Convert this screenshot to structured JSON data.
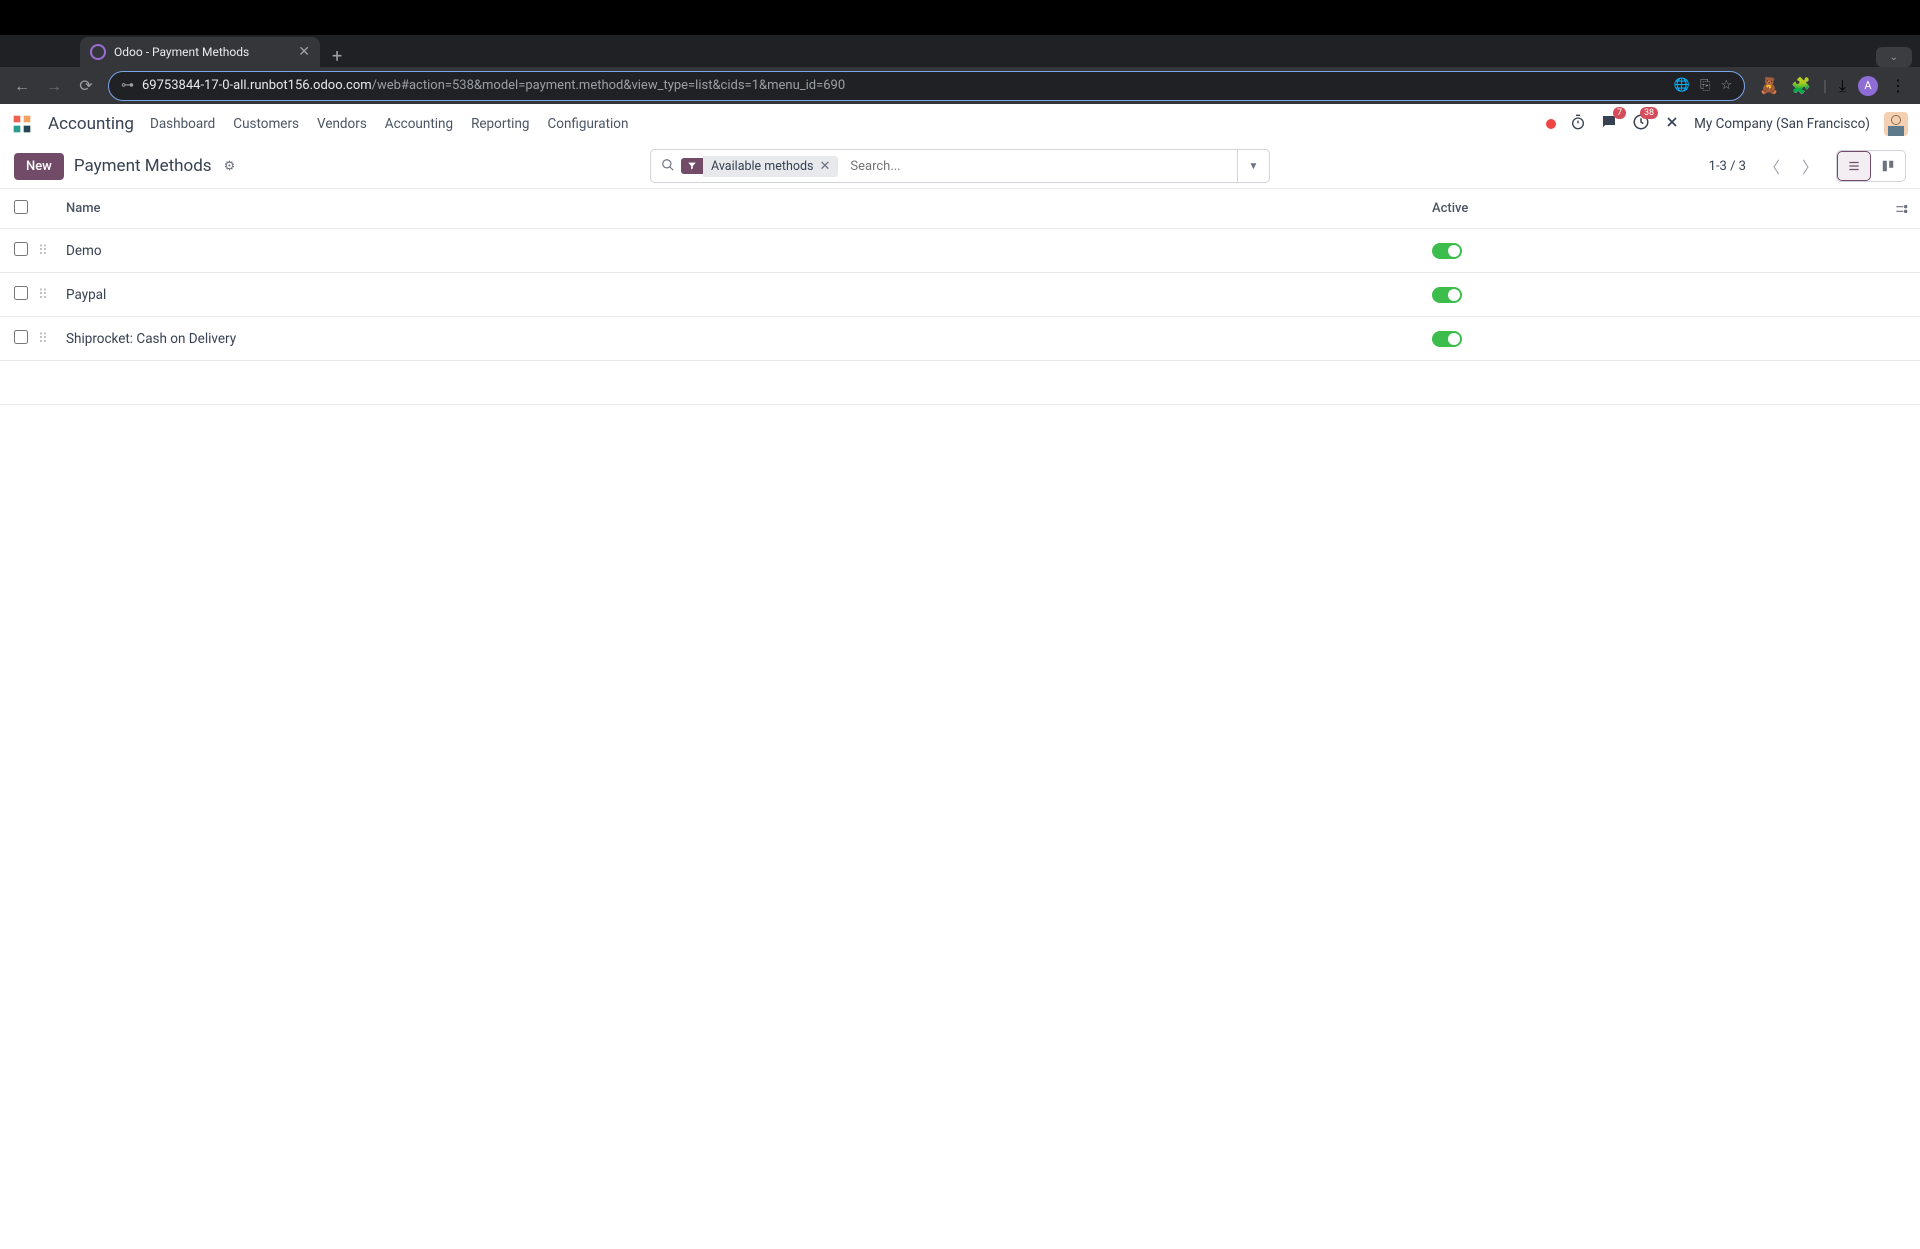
{
  "browser": {
    "tab_title": "Odoo - Payment Methods",
    "url_host": "69753844-17-0-all.runbot156.odoo.com",
    "url_path": "/web#action=538&model=payment.method&view_type=list&cids=1&menu_id=690",
    "profile_letter": "A"
  },
  "app": {
    "name": "Accounting",
    "nav": [
      "Dashboard",
      "Customers",
      "Vendors",
      "Accounting",
      "Reporting",
      "Configuration"
    ],
    "chat_badge": "7",
    "schedule_badge": "38",
    "company": "My Company (San Francisco)"
  },
  "control": {
    "new_label": "New",
    "title": "Payment Methods",
    "filter_label": "Available methods",
    "search_placeholder": "Search...",
    "pager": "1-3 / 3"
  },
  "table": {
    "headers": {
      "name": "Name",
      "active": "Active"
    },
    "rows": [
      {
        "name": "Demo",
        "active": true
      },
      {
        "name": "Paypal",
        "active": true
      },
      {
        "name": "Shiprocket: Cash on Delivery",
        "active": true
      }
    ]
  }
}
